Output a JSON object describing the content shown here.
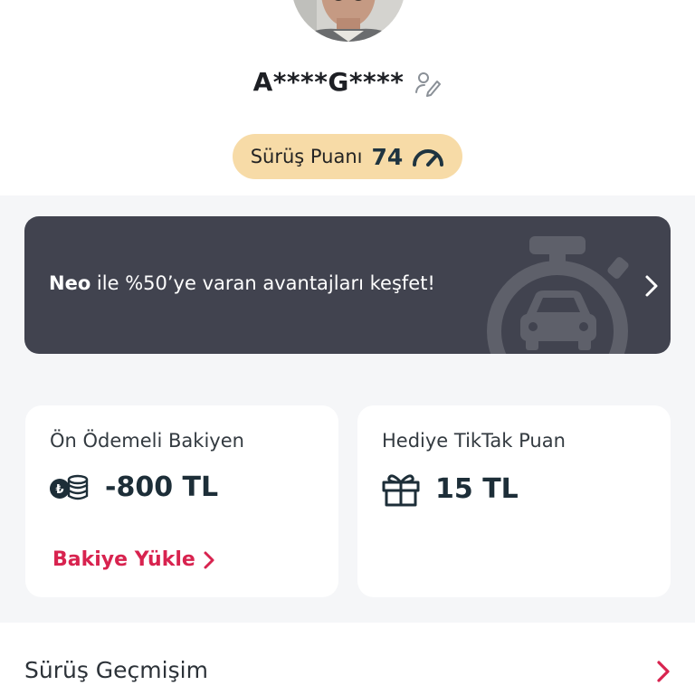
{
  "profile": {
    "name": "A****G****",
    "avatar_icon": "user-photo",
    "edit_icon": "edit-pencil-icon"
  },
  "driving_score": {
    "label": "Sürüş Puanı",
    "value": "74",
    "icon": "speedometer-gauge-icon",
    "pill_color": "#f7dba7"
  },
  "promo": {
    "brand": "Neo",
    "text": " ile %50’ye varan avantajları keşfet!",
    "background": "#41434f",
    "illustration_icon": "stopwatch-car-icon"
  },
  "balance_card": {
    "title": "Ön Ödemeli Bakiyen",
    "value": "-800 TL",
    "icon": "coins-icon",
    "action_label": "Bakiye Yükle",
    "accent": "#d8234f"
  },
  "gift_card": {
    "title": "Hediye TikTak Puan",
    "value": "15 TL",
    "icon": "gift-icon"
  },
  "menu": {
    "history_label": "Sürüş Geçmişim"
  }
}
